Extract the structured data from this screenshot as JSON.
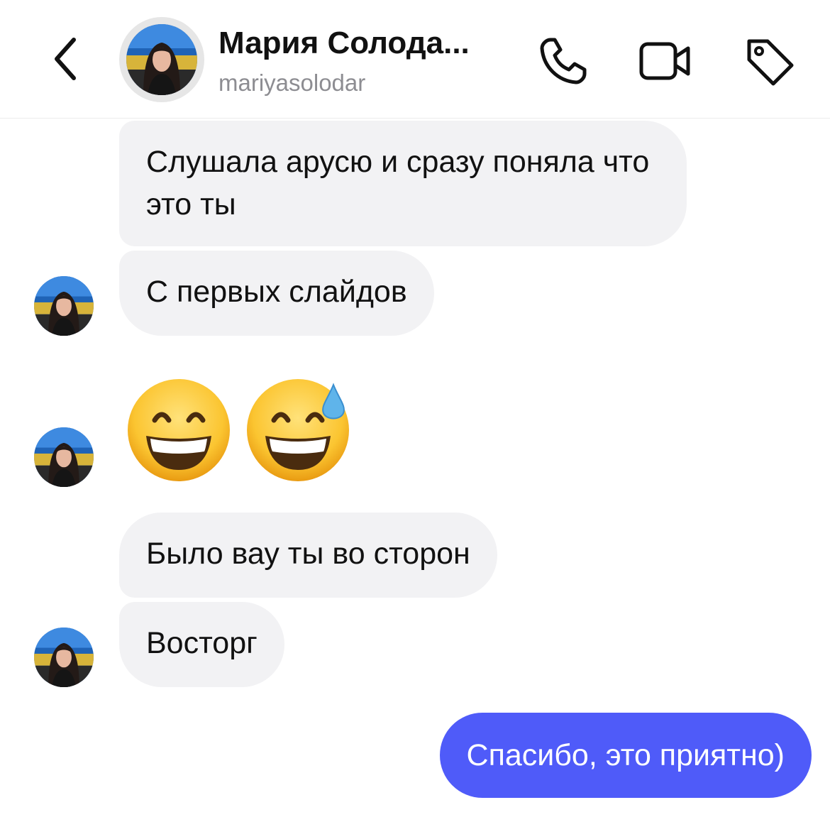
{
  "header": {
    "contact_name": "Мария Солода...",
    "username": "mariyasolodar",
    "back_icon": "chevron-left-icon",
    "call_icon": "phone-icon",
    "video_icon": "video-camera-icon",
    "tag_icon": "tag-icon"
  },
  "messages": [
    {
      "sender": "contact",
      "text": "Слушала арусю и сразу поняла что это ты"
    },
    {
      "sender": "contact",
      "text": "С первых слайдов"
    },
    {
      "sender": "contact",
      "type": "emoji",
      "emojis": [
        "grinning-face-with-smiling-eyes",
        "grinning-face-with-sweat"
      ]
    },
    {
      "sender": "contact",
      "text": "Было вау ты во сторон"
    },
    {
      "sender": "contact",
      "text": "Восторг"
    },
    {
      "sender": "me",
      "text": "Спасибо, это приятно)"
    }
  ],
  "colors": {
    "sent_bubble": "#4f5bf9",
    "received_bubble": "#f2f2f4",
    "username": "#8d8d92"
  }
}
